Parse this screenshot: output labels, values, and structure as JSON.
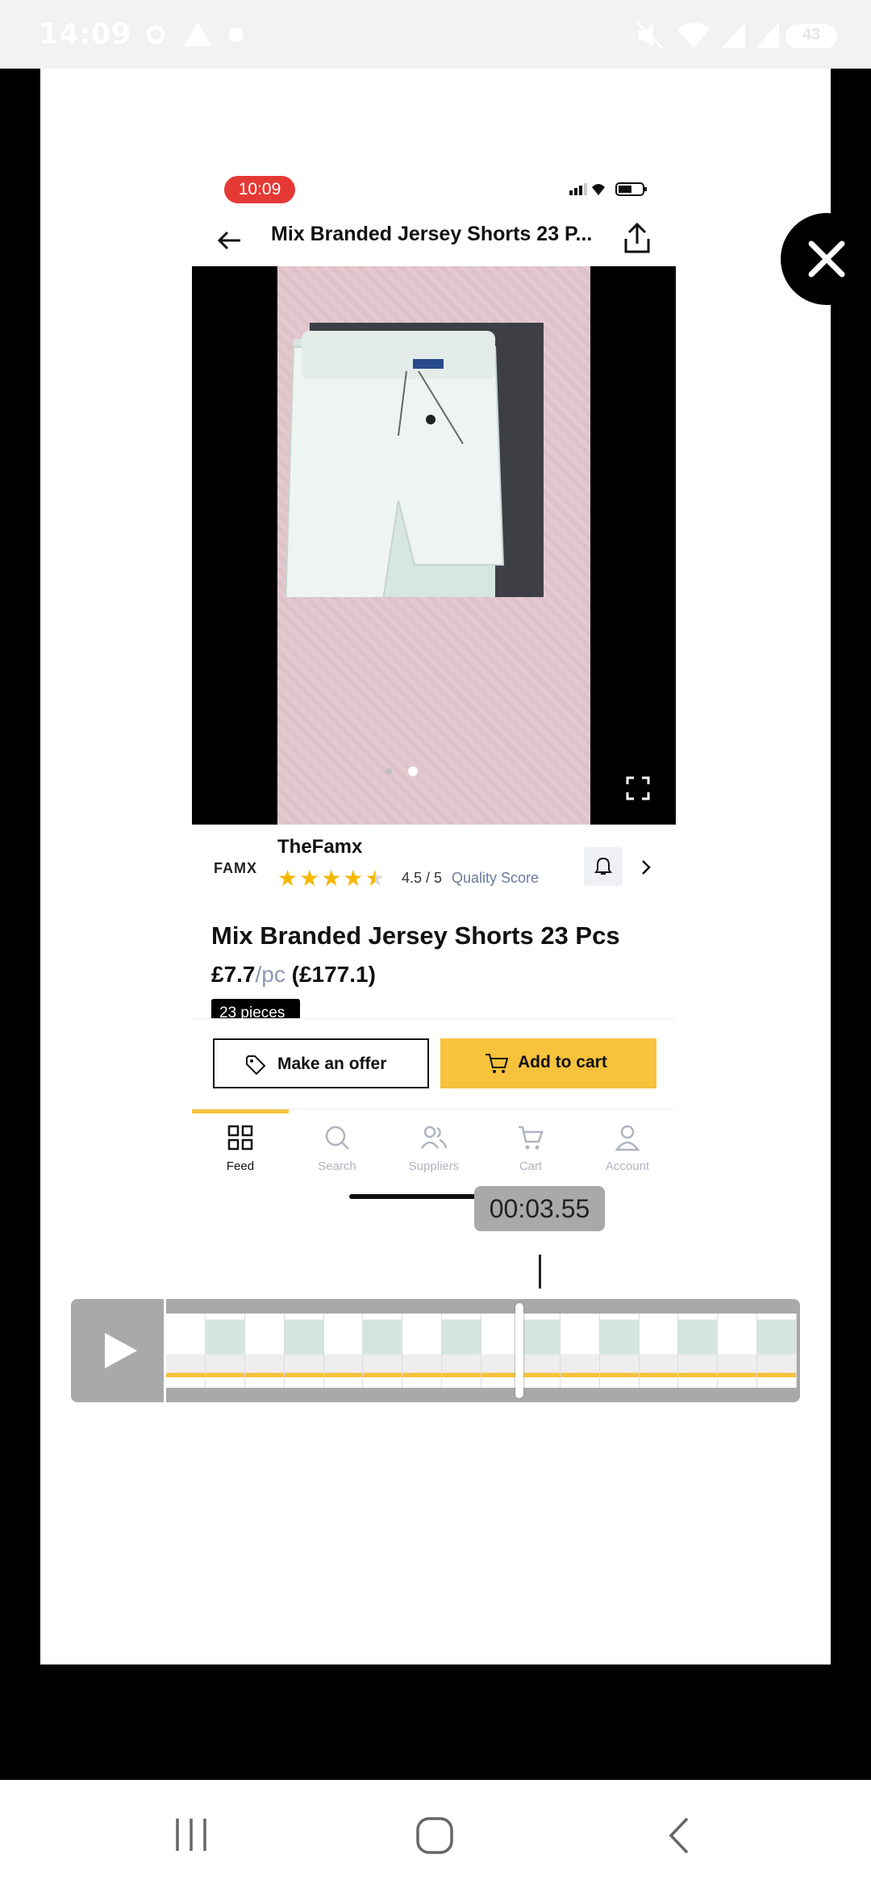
{
  "status_bar": {
    "time": "14:09",
    "battery": "43"
  },
  "inner_screen": {
    "time": "10:09",
    "header": {
      "title": "Mix Branded Jersey Shorts 23 P..."
    },
    "seller": {
      "logo_text": "FAMX",
      "name": "TheFamx",
      "rating": 4.5,
      "score_text": "4.5 / 5",
      "score_label": "Quality Score"
    },
    "product": {
      "name": "Mix Branded Jersey Shorts 23 Pcs",
      "price": "£7.7",
      "price_unit": "/pc",
      "total": "(£177.1)",
      "pieces_badge": "23 pieces"
    },
    "actions": {
      "offer_label": "Make an offer",
      "cart_label": "Add to cart"
    },
    "tabs": [
      {
        "label": "Feed",
        "icon": "grid-icon",
        "active": true
      },
      {
        "label": "Search",
        "icon": "search-icon",
        "active": false
      },
      {
        "label": "Suppliers",
        "icon": "users-icon",
        "active": false
      },
      {
        "label": "Cart",
        "icon": "cart-icon",
        "active": false
      },
      {
        "label": "Account",
        "icon": "person-icon",
        "active": false
      }
    ]
  },
  "editor": {
    "timestamp": "00:03.55",
    "playhead_fraction": 0.56
  },
  "colors": {
    "accent": "#f7c23c",
    "time_pill": "#e53935",
    "star": "#f5b800"
  }
}
